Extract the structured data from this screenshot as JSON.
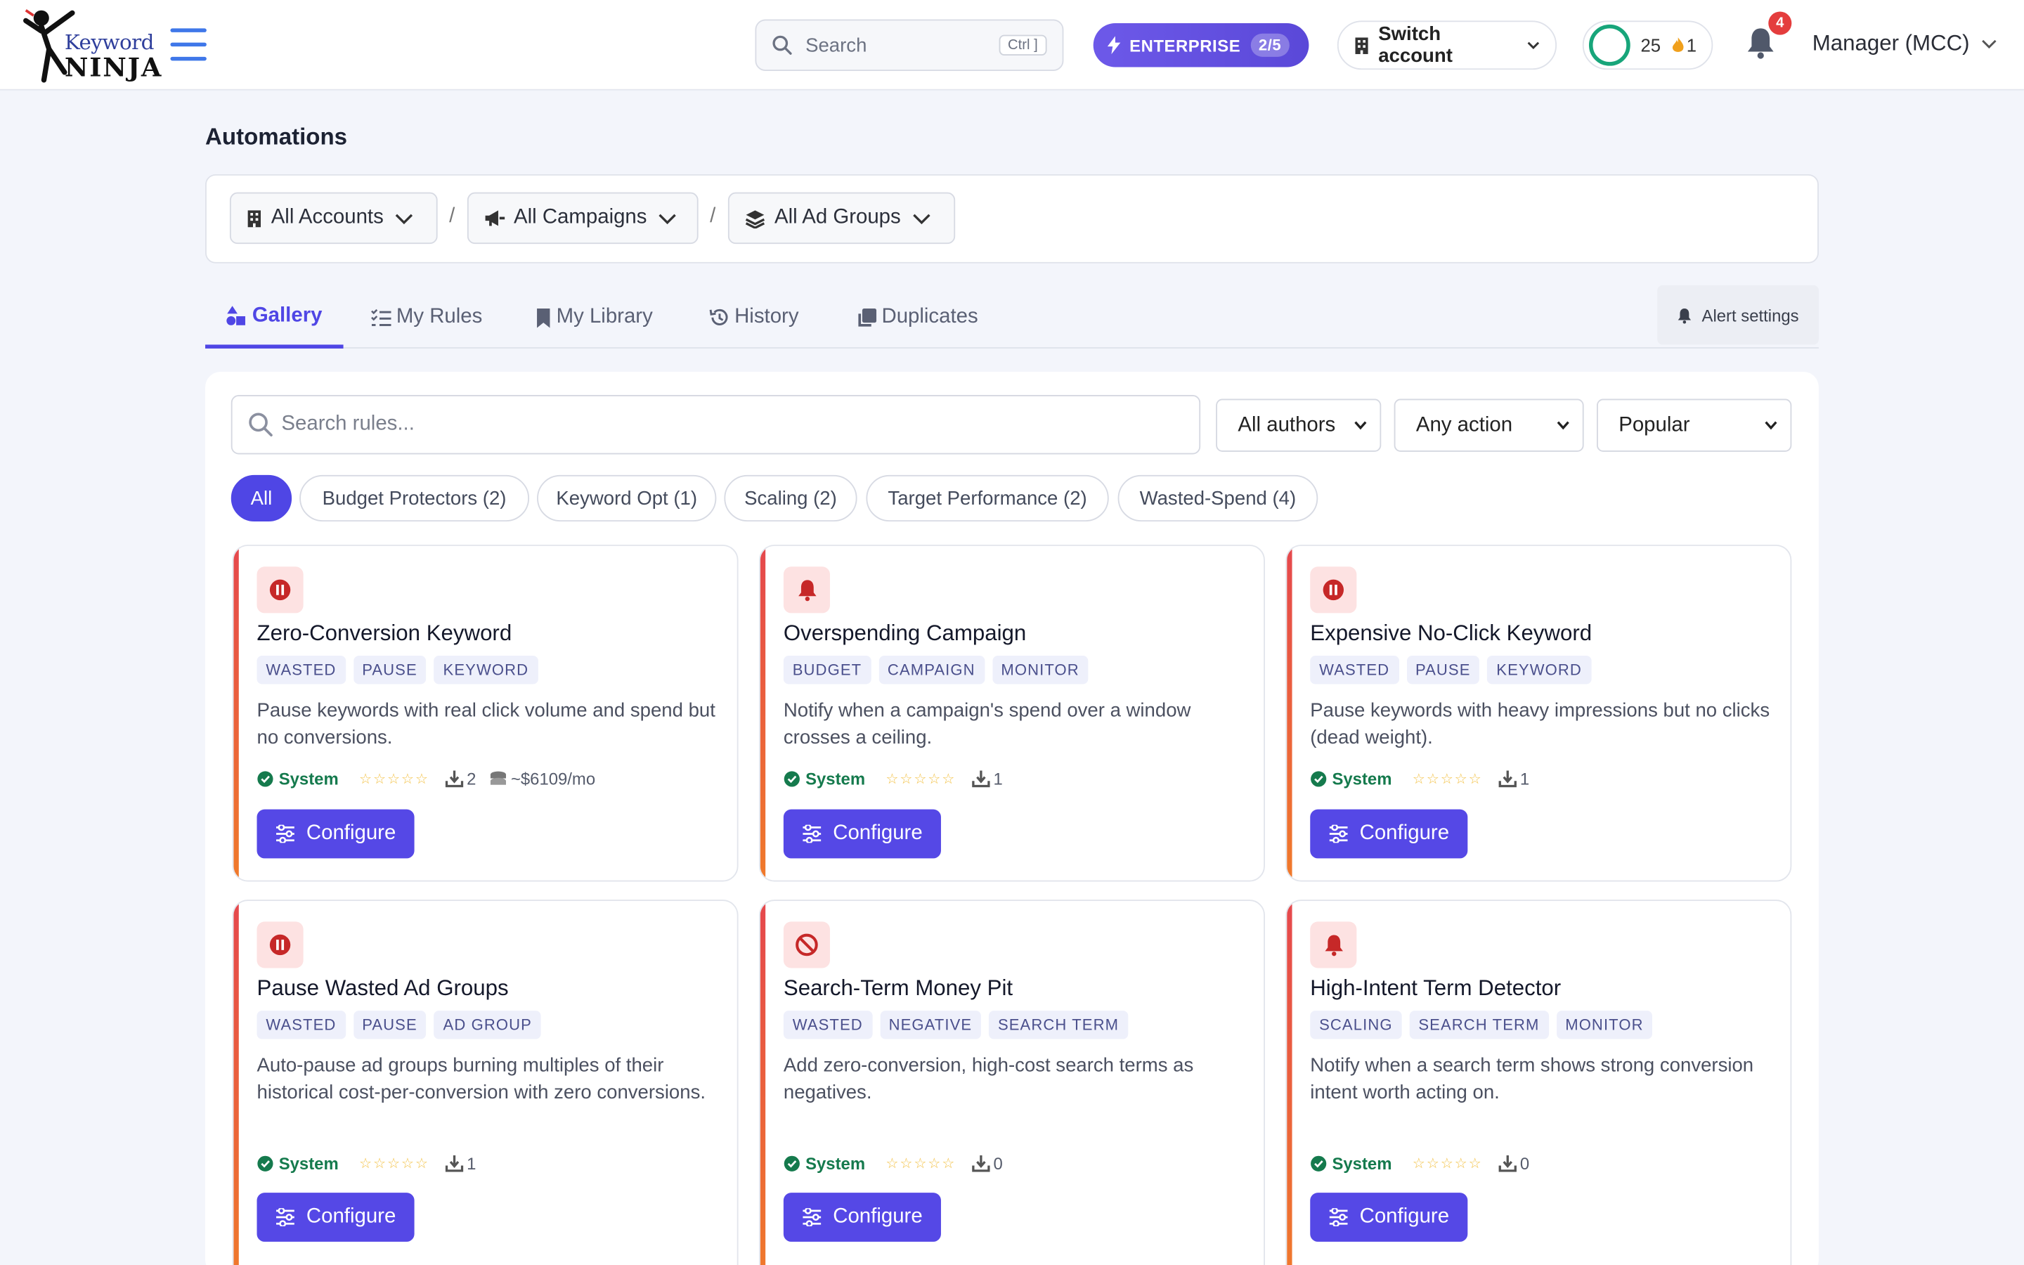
{
  "header": {
    "logo_top": "Keyword",
    "logo_bottom": "NINJA",
    "search_placeholder": "Search",
    "search_shortcut": "Ctrl ]",
    "plan_label": "ENTERPRISE",
    "plan_quota": "2/5",
    "switch_account_label": "Switch account",
    "score": "25",
    "streak": "1",
    "notification_count": "4",
    "account_name": "Manager (MCC)"
  },
  "page": {
    "title": "Automations",
    "scope": {
      "accounts": "All Accounts",
      "campaigns": "All Campaigns",
      "ad_groups": "All Ad Groups",
      "separator": "/"
    },
    "tabs": [
      {
        "label": "Gallery",
        "active": true
      },
      {
        "label": "My Rules"
      },
      {
        "label": "My Library"
      },
      {
        "label": "History"
      },
      {
        "label": "Duplicates"
      }
    ],
    "alert_settings_label": "Alert settings"
  },
  "gallery": {
    "search_placeholder": "Search rules...",
    "author_filter": "All authors",
    "action_filter": "Any action",
    "sort": "Popular",
    "categories": [
      "All",
      "Budget Protectors (2)",
      "Keyword Opt (1)",
      "Scaling (2)",
      "Target Performance (2)",
      "Wasted-Spend (4)"
    ],
    "configure_label": "Configure",
    "author_label": "System",
    "cards": [
      {
        "icon": "pause-icon",
        "title": "Zero-Conversion Keyword",
        "tags": [
          "WASTED",
          "PAUSE",
          "KEYWORD"
        ],
        "description": "Pause keywords with real click volume and spend but no conversions.",
        "downloads": "2",
        "spend": "~$6109/mo"
      },
      {
        "icon": "bell-icon",
        "title": "Overspending Campaign",
        "tags": [
          "BUDGET",
          "CAMPAIGN",
          "MONITOR"
        ],
        "description": "Notify when a campaign's spend over a window crosses a ceiling.",
        "downloads": "1"
      },
      {
        "icon": "pause-icon",
        "title": "Expensive No-Click Keyword",
        "tags": [
          "WASTED",
          "PAUSE",
          "KEYWORD"
        ],
        "description": "Pause keywords with heavy impressions but no clicks (dead weight).",
        "downloads": "1"
      },
      {
        "icon": "pause-icon",
        "title": "Pause Wasted Ad Groups",
        "tags": [
          "WASTED",
          "PAUSE",
          "AD GROUP"
        ],
        "description": "Auto-pause ad groups burning multiples of their historical cost-per-conversion with zero conversions.",
        "downloads": "1"
      },
      {
        "icon": "ban-icon",
        "title": "Search-Term Money Pit",
        "tags": [
          "WASTED",
          "NEGATIVE",
          "SEARCH TERM"
        ],
        "description": "Add zero-conversion, high-cost search terms as negatives.",
        "downloads": "0"
      },
      {
        "icon": "bell-icon",
        "title": "High-Intent Term Detector",
        "tags": [
          "SCALING",
          "SEARCH TERM",
          "MONITOR"
        ],
        "description": "Notify when a search term shows strong conversion intent worth acting on.",
        "downloads": "0"
      }
    ]
  },
  "colors": {
    "accent": "#4f46e5",
    "danger": "#e5484d",
    "success": "#157a4d"
  }
}
